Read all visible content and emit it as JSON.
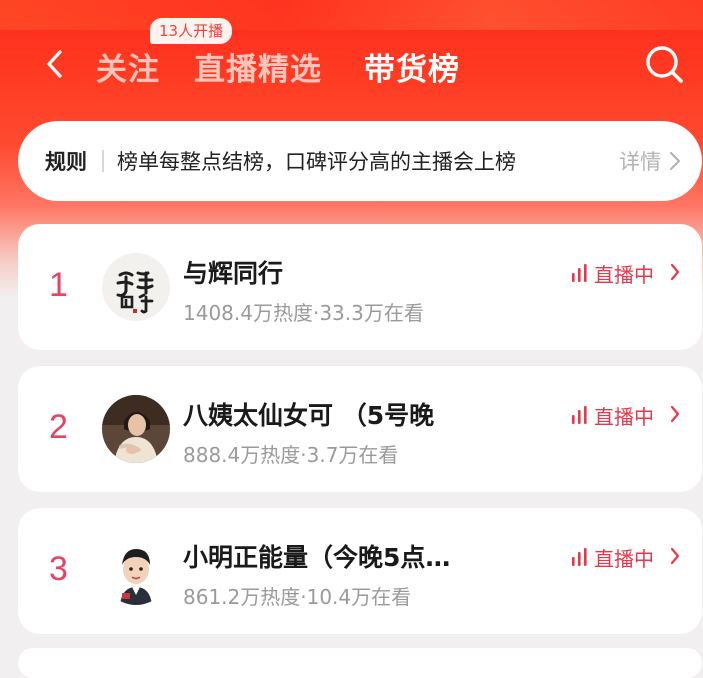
{
  "nav": {
    "live_count_badge": "13人开播",
    "tabs": [
      {
        "label": "关注",
        "active": false
      },
      {
        "label": "直播精选",
        "active": false
      },
      {
        "label": "带货榜",
        "active": true
      }
    ]
  },
  "rules": {
    "title": "规则",
    "text": "榜单每整点结榜，口碑评分高的主播会上榜",
    "more_label": "详情"
  },
  "ranking": [
    {
      "rank": "1",
      "name": "与辉同行",
      "stats": "1408.4万热度·33.3万在看",
      "status": "直播中"
    },
    {
      "rank": "2",
      "name": "八姨太仙女可 （5号晚",
      "stats": "888.4万热度·3.7万在看",
      "status": "直播中"
    },
    {
      "rank": "3",
      "name": "小明正能量（今晚5点…",
      "stats": "861.2万热度·10.4万在看",
      "status": "直播中"
    }
  ],
  "colors": {
    "brand_red": "#ff2a1c",
    "rank_color": "#e84263",
    "live_color": "#e8374a"
  },
  "icons": {
    "back": "chevron-left-icon",
    "search": "search-icon",
    "live": "live-bars-icon",
    "more": "chevron-right-icon"
  }
}
